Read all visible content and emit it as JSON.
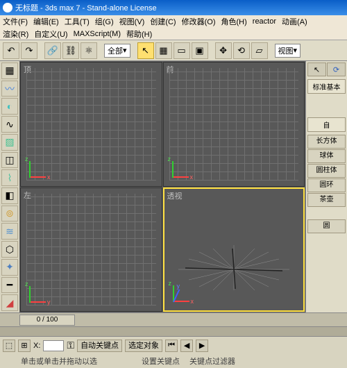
{
  "title": "无标题 - 3ds max 7 - Stand-alone License",
  "menu": {
    "file": "文件(F)",
    "edit": "编辑(E)",
    "tools": "工具(T)",
    "group": "组(G)",
    "views": "视图(V)",
    "create": "创建(C)",
    "modifiers": "修改器(O)",
    "character": "角色(H)",
    "reactor": "reactor",
    "animation": "动画(A)",
    "rendering": "渲染(R)",
    "customize": "自定义(U)",
    "maxscript": "MAXScript(M)",
    "help": "帮助(H)"
  },
  "toolbar": {
    "selection_filter": "全部",
    "ref_coord": "视图"
  },
  "viewports": {
    "top": "顶",
    "front": "前",
    "left": "左",
    "perspective": "透视",
    "axis_x": "x",
    "axis_y": "y",
    "axis_z": "z"
  },
  "cmdpanel": {
    "rollout_label": "标准基本",
    "section_label": "自",
    "items": [
      "长方体",
      "球体",
      "圆柱体",
      "圆环",
      "茶壶",
      "圆"
    ]
  },
  "timeline": {
    "current": "0 / 100"
  },
  "status": {
    "x_label": "X:",
    "autokey": "自动关键点",
    "selected": "选定对象",
    "hint": "单击或单击并拖动以选",
    "setkey": "设置关键点",
    "keyfilter": "关键点过滤器"
  }
}
